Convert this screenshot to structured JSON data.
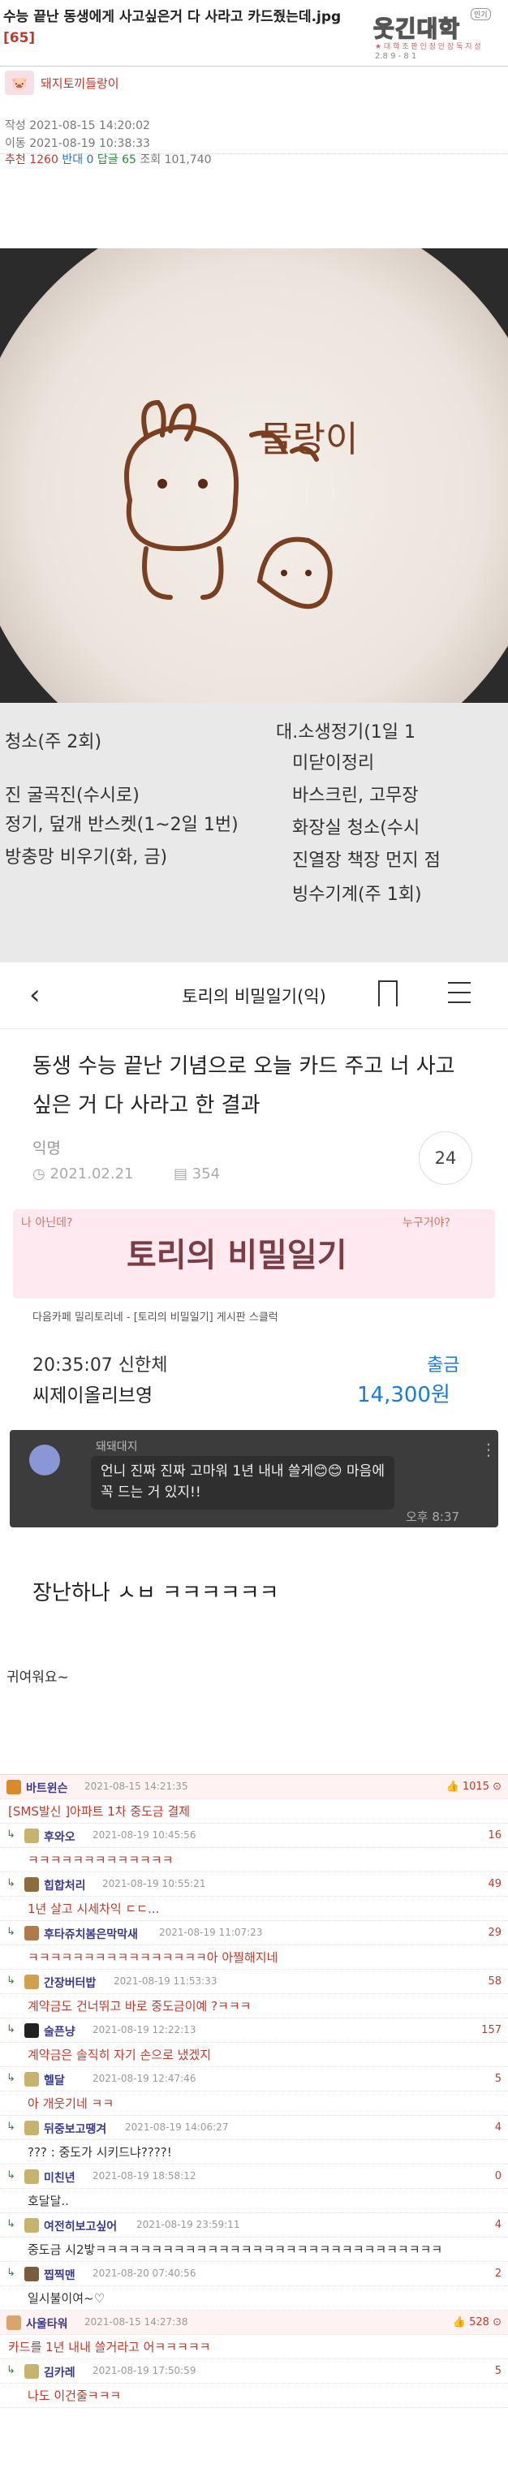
{
  "post": {
    "title": "수능 끝난 동생에게 사고싶은거 다 사라고 카드줬는데.jpg",
    "comment_count": "[65]",
    "author": "돼지토끼들랑이",
    "created": "작성 2021-08-15 14:20:02",
    "moved": "이동 2021-08-19 10:38:33",
    "stats": {
      "recommend_label": "추천",
      "recommend": "1260",
      "oppose_label": "반대",
      "oppose": "0",
      "answer_label": "답글",
      "answer": "65",
      "views_label": "조회",
      "views": "101,740"
    }
  },
  "logo": {
    "brand": "웃긴대학",
    "badge": "인기",
    "sub": "★ 대 학 조 판 인 정 안 장 독 지 성",
    "date": "2.8 9 - 8 1"
  },
  "latte_text": [
    "빙수기계(주 1회)",
    "진열장 책장 먼지 점",
    "화장실 청소(수시",
    "바스크린, 고무장",
    "미닫이정리",
    "대.소생정기(1일 1",
    "청소(주 2회)",
    "진 굴곡진(수시로)",
    "정기, 덮개 반스켓(1~2일 1번)",
    "방충망 비우기(화, 금)",
    "물랑이"
  ],
  "card": {
    "nav_title": "토리의 비밀일기(익)",
    "post_title": "동생 수능 끝난 기념으로 오늘 카드 주고 너 사고 싶은 거 다 사라고 한 결과",
    "author": "익명",
    "date": "2021.02.21",
    "views": "354",
    "comments": "24",
    "banner_title": "토리의 비밀일기",
    "banner_left": "나 아닌데?",
    "banner_right": "누구거야?",
    "source": "다음카페 밀리토리네 - [토리의 비밀일기] 게시판 스클럭",
    "tx_time": "20:35:07 신한체",
    "tx_store": "씨제이올리브영",
    "tx_type": "출금",
    "tx_amount": "14,300원",
    "chat_name": "돼돼대지",
    "chat_text": "언니 진짜 진짜 고마워 1년 내내 쓸게😊😊 마음에 꼭 드는 거 있지!!",
    "chat_time": "오후 8:37",
    "joke": "장난하나 ㅅㅂ ㅋㅋㅋㅋㅋㅋ"
  },
  "cute_comment": "귀여워요~",
  "comments": [
    {
      "name": "바트윈슨",
      "date": "2021-08-15 14:21:35",
      "likes": "1015",
      "top": true,
      "icon_color": "#d98a2c",
      "text": "[SMS발신 ]아파트 1차 중도금 결제",
      "text_dark": false
    },
    {
      "name": "후와오",
      "date": "2021-08-19 10:45:56",
      "likes": "16",
      "top": false,
      "icon_color": "#c7b36e",
      "text": "ㅋㅋㅋㅋㅋㅋㅋㅋㅋㅋㅋㅋㅋ",
      "text_dark": false
    },
    {
      "name": "힙합처리",
      "date": "2021-08-19 10:55:21",
      "likes": "49",
      "top": false,
      "icon_color": "#8c6b3c",
      "text": "1년 살고 시세차익 ㄷㄷ...",
      "text_dark": false
    },
    {
      "name": "후타쥬치봄은막막새",
      "date": "2021-08-19 11:07:23",
      "likes": "29",
      "top": false,
      "icon_color": "#b07a4a",
      "text": "ㅋㅋㅋㅋㅋㅋㅋㅋㅋㅋㅋㅋㅋㅋㅋㅋ아 아찔해지네",
      "text_dark": false
    },
    {
      "name": "간장버터밥",
      "date": "2021-08-19 11:53:33",
      "likes": "58",
      "top": false,
      "icon_color": "#d0a050",
      "text": "계약금도 건너뛰고 바로 중도금이예 ?ㅋㅋㅋ",
      "text_dark": false
    },
    {
      "name": "술픈냥",
      "date": "2021-08-19 12:22:13",
      "likes": "157",
      "top": false,
      "icon_color": "#222222",
      "text": "계약금은 솔직히 자기 손으로 냈겠지",
      "text_dark": false
    },
    {
      "name": "헬달",
      "date": "2021-08-19 12:47:46",
      "likes": "5",
      "top": false,
      "icon_color": "#c7b36e",
      "text": "아 개웃기네 ㅋㅋ",
      "text_dark": false
    },
    {
      "name": "뒤중보고땡겨",
      "date": "2021-08-19 14:06:27",
      "likes": "4",
      "top": false,
      "icon_color": "#c7b36e",
      "text": "??? : 중도가 시키드냐????!",
      "text_dark": true
    },
    {
      "name": "미친년",
      "date": "2021-08-19 18:58:12",
      "likes": "0",
      "top": false,
      "icon_color": "#c7b36e",
      "text": "호달달..",
      "text_dark": true
    },
    {
      "name": "여전히보고싶어",
      "date": "2021-08-19 23:59:11",
      "likes": "4",
      "top": false,
      "icon_color": "#c7b36e",
      "text": "중도금 시2밯ㅋㅋㅋㅋㅋㅋㅋㅋㅋㅋㅋㅋㅋㅋㅋㅋㅋㅋㅋㅋㅋㅋㅋㅋㅋㅋㅋㅋㅋㅋㅋ",
      "text_dark": true
    },
    {
      "name": "찝찍맨",
      "date": "2021-08-20 07:40:56",
      "likes": "2",
      "top": false,
      "icon_color": "#7a5c3e",
      "text": "일시불이여~♡",
      "text_dark": true
    },
    {
      "name": "사울타워",
      "date": "2021-08-15 14:27:38",
      "likes": "528",
      "top": true,
      "icon_color": "#d9a56a",
      "text": "카드를 1년 내내 쓸거라고 어ㅋㅋㅋㅋㅋ",
      "text_dark": false
    },
    {
      "name": "김카레",
      "date": "2021-08-19 17:50:59",
      "likes": "5",
      "top": false,
      "icon_color": "#c7b36e",
      "text": "나도 이건줄ㅋㅋㅋ",
      "text_dark": false
    }
  ],
  "colors": {
    "accent": "#c0392b",
    "link": "#3a3a8c",
    "blue": "#1e7bd3"
  }
}
